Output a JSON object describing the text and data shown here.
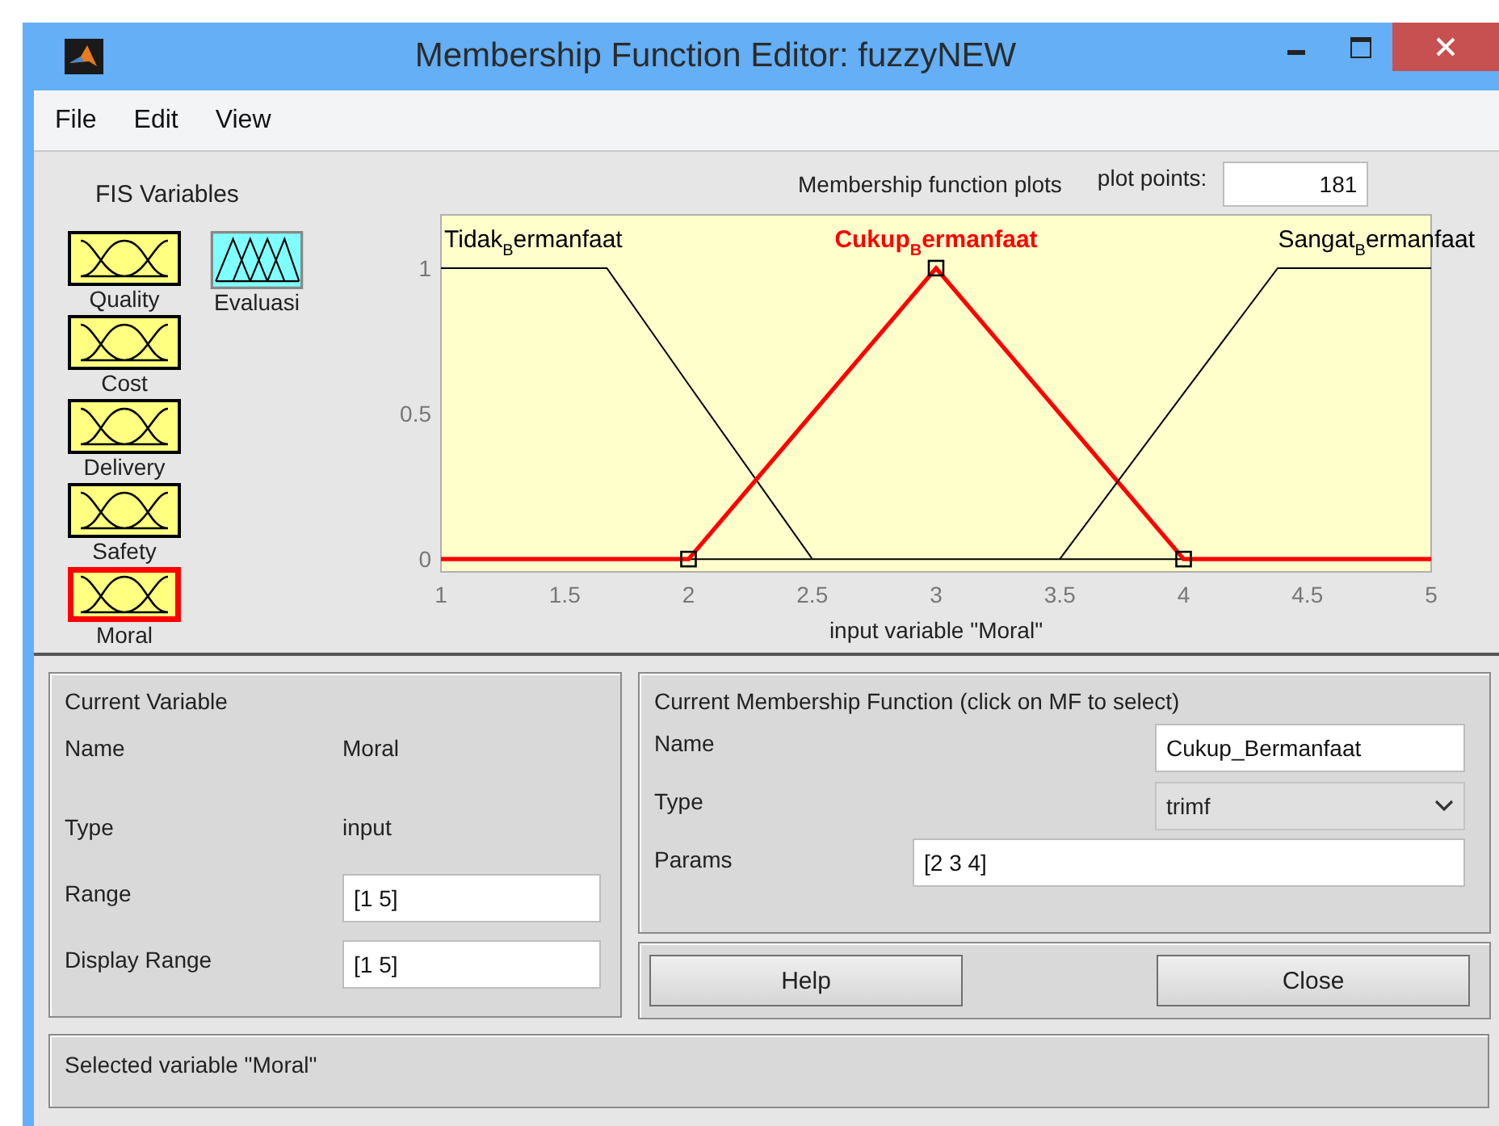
{
  "window": {
    "title": "Membership Function Editor: fuzzyNEW"
  },
  "menu": [
    "File",
    "Edit",
    "View"
  ],
  "fis_variables": {
    "title": "FIS Variables",
    "items": [
      {
        "name": "Quality",
        "kind": "input",
        "selected": false
      },
      {
        "name": "Evaluasi",
        "kind": "output",
        "selected": false
      },
      {
        "name": "Cost",
        "kind": "input",
        "selected": false
      },
      {
        "name": "Delivery",
        "kind": "input",
        "selected": false
      },
      {
        "name": "Safety",
        "kind": "input",
        "selected": false
      },
      {
        "name": "Moral",
        "kind": "input",
        "selected": true
      }
    ]
  },
  "plot": {
    "title": "Membership function plots",
    "plot_points_label": "plot points:",
    "plot_points": "181",
    "curves": [
      {
        "selected": false
      },
      {
        "selected": true
      },
      {
        "selected": false
      }
    ],
    "chart_data": {
      "type": "line",
      "xlabel": "input variable \"Moral\"",
      "x": [
        1,
        1.67,
        2,
        2.5,
        3,
        3.5,
        4,
        4.38,
        5
      ],
      "xlim": [
        1,
        5
      ],
      "ylim": [
        -0.044,
        1.183
      ],
      "xticks": [
        1,
        1.5,
        2,
        2.5,
        3,
        3.5,
        4,
        4.5,
        5
      ],
      "yticks": [
        0,
        0.5,
        1
      ],
      "series": [
        {
          "name": "Tidak$_{B}$ermanfaat",
          "color": "#000000",
          "values": [
            1,
            1,
            0.6,
            0,
            null,
            null,
            null,
            null,
            null
          ]
        },
        {
          "name": "Cukup$_{B}$ermanfaat",
          "color": "#ff0000",
          "values": [
            0,
            0,
            0,
            0.5,
            1,
            0.5,
            0,
            0,
            0
          ]
        },
        {
          "name": "Sangat$_{B}$ermanfaat",
          "color": "#000000",
          "values": [
            null,
            null,
            null,
            null,
            null,
            0,
            0.57,
            1,
            1
          ]
        }
      ]
    }
  },
  "current_variable": {
    "title": "Current Variable",
    "rows": [
      {
        "label": "Name",
        "kind": "text",
        "value": "Moral"
      },
      {
        "label": "Type",
        "kind": "text",
        "value": "input"
      },
      {
        "label": "Range",
        "kind": "field",
        "value": "[1 5]"
      },
      {
        "label": "Display Range",
        "kind": "field",
        "value": "[1 5]"
      }
    ]
  },
  "current_mf": {
    "title": "Current Membership Function (click on MF to select)",
    "name_label": "Name",
    "name": "Cukup_Bermanfaat",
    "type_label": "Type",
    "type": "trimf",
    "params_label": "Params",
    "params": "[2 3 4]"
  },
  "buttons": [
    "Help",
    "Close"
  ],
  "status": "Selected variable \"Moral\""
}
